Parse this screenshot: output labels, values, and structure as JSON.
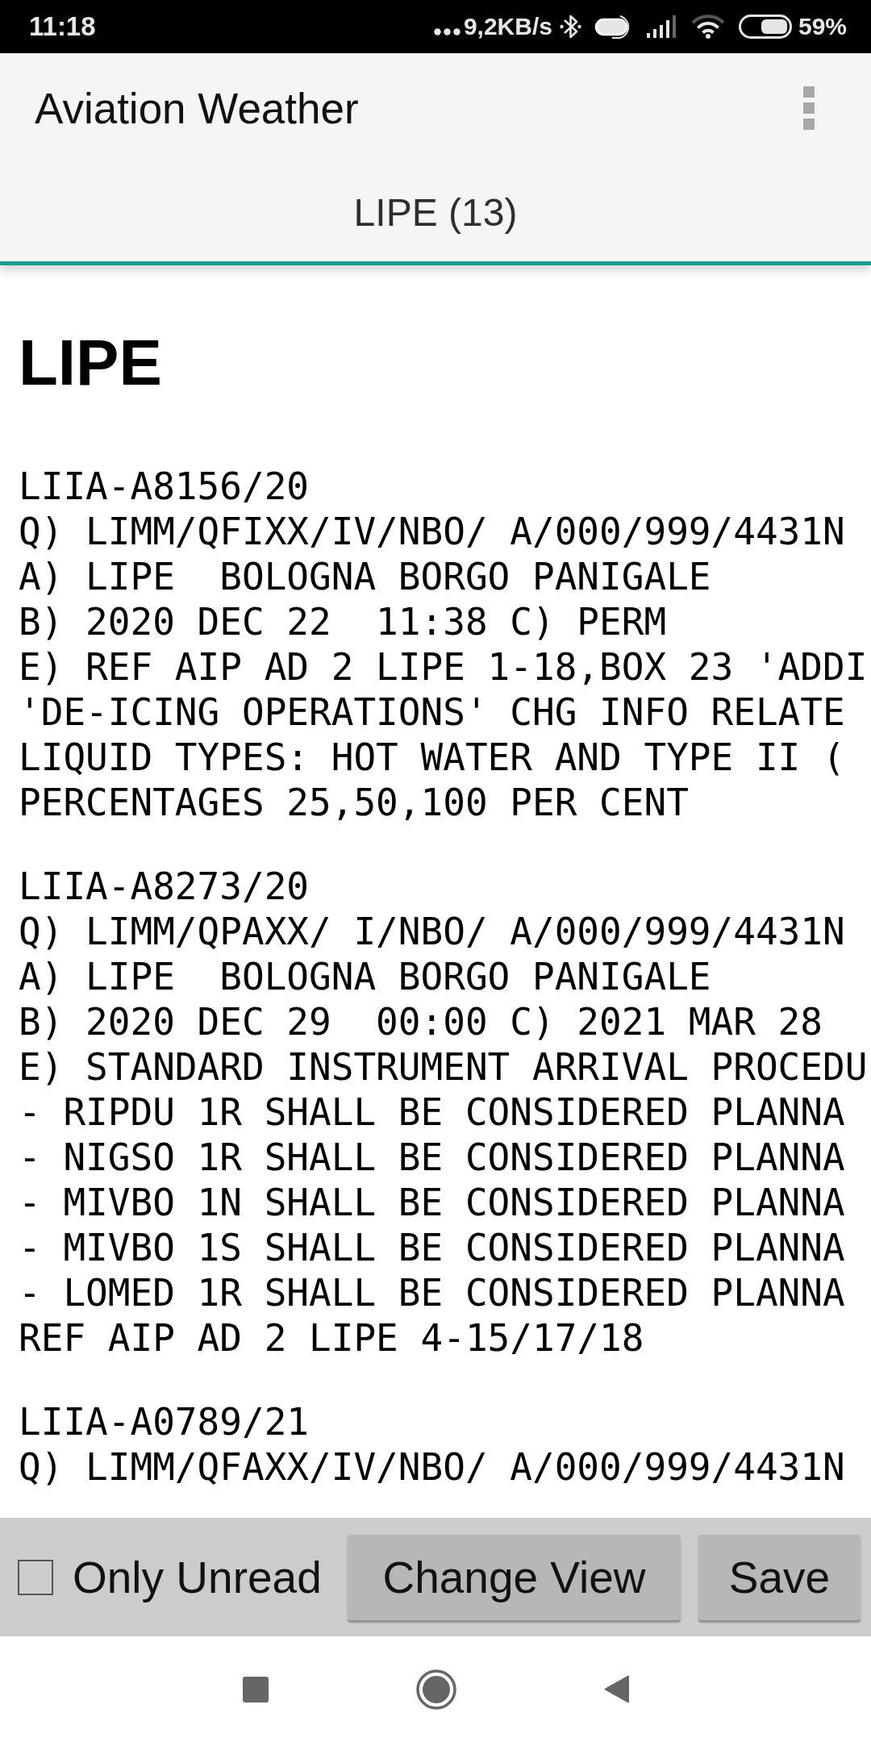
{
  "status_bar": {
    "time": "11:18",
    "network_speed": "9,2KB/s",
    "battery": "59%"
  },
  "app_bar": {
    "title": "Aviation Weather"
  },
  "tabs": [
    {
      "label": "LIPE (13)",
      "selected": true
    }
  ],
  "content": {
    "heading": "LIPE",
    "notams": [
      {
        "lines": [
          "LIIA-A8156/20",
          "Q) LIMM/QFIXX/IV/NBO/ A/000/999/4431N",
          "A) LIPE  BOLOGNA BORGO PANIGALE",
          "B) 2020 DEC 22  11:38 C) PERM",
          "E) REF AIP AD 2 LIPE 1-18,BOX 23 'ADDI",
          "'DE-ICING OPERATIONS' CHG INFO RELATE",
          "LIQUID TYPES: HOT WATER AND TYPE II (",
          "PERCENTAGES 25,50,100 PER CENT"
        ]
      },
      {
        "lines": [
          "LIIA-A8273/20",
          "Q) LIMM/QPAXX/ I/NBO/ A/000/999/4431N",
          "A) LIPE  BOLOGNA BORGO PANIGALE",
          "B) 2020 DEC 29  00:00 C) 2021 MAR 28",
          "E) STANDARD INSTRUMENT ARRIVAL PROCEDU",
          "- RIPDU 1R SHALL BE CONSIDERED PLANNA",
          "- NIGSO 1R SHALL BE CONSIDERED PLANNA",
          "- MIVBO 1N SHALL BE CONSIDERED PLANNA",
          "- MIVBO 1S SHALL BE CONSIDERED PLANNA",
          "- LOMED 1R SHALL BE CONSIDERED PLANNA",
          "REF AIP AD 2 LIPE 4-15/17/18"
        ]
      },
      {
        "lines": [
          "LIIA-A0789/21",
          "Q) LIMM/QFAXX/IV/NBO/ A/000/999/4431N"
        ]
      }
    ]
  },
  "bottom_bar": {
    "only_unread": {
      "label": "Only Unread",
      "checked": false
    },
    "buttons": [
      {
        "label": "Change View"
      },
      {
        "label": "Save"
      }
    ]
  }
}
